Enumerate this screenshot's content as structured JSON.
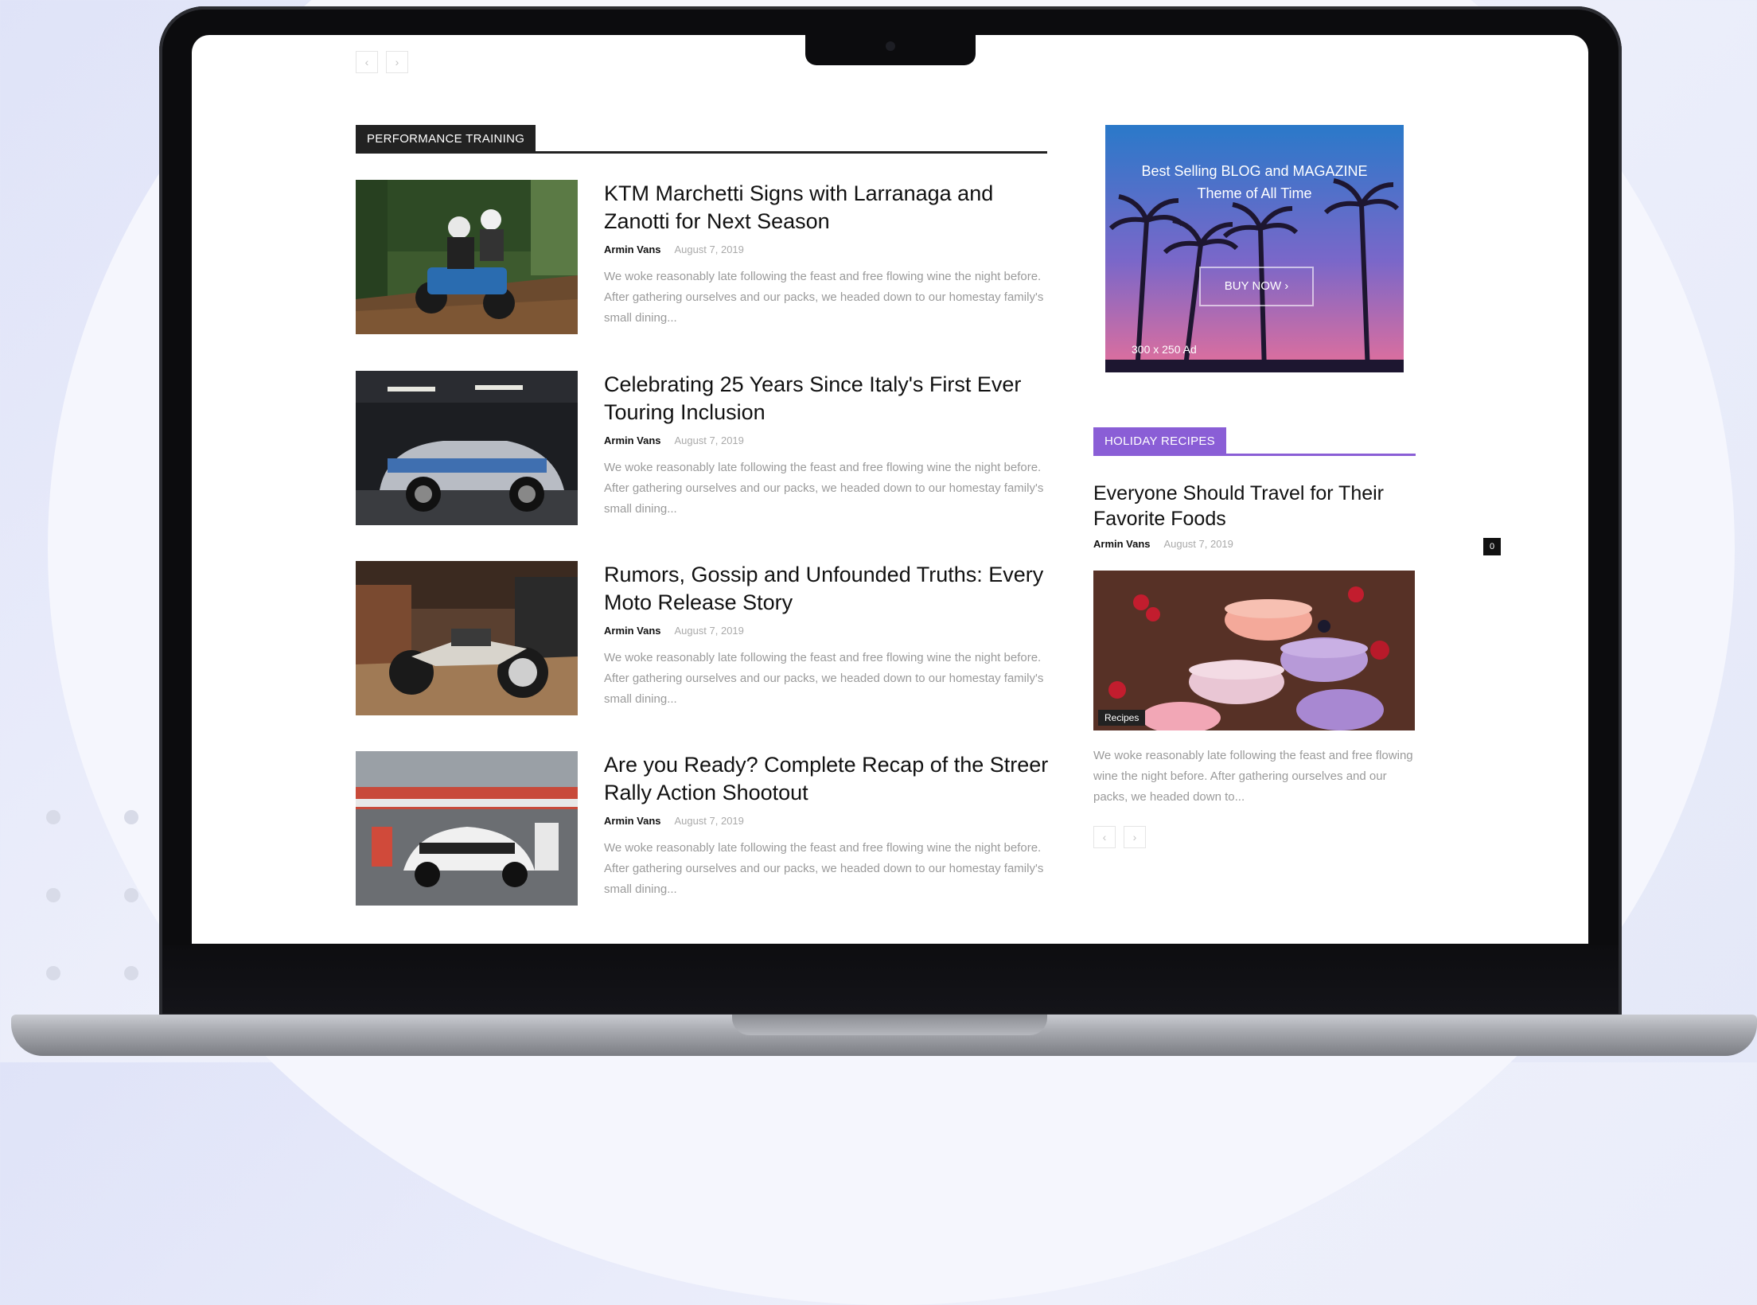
{
  "top_pager": {
    "prev": "‹",
    "next": "›"
  },
  "main": {
    "section_label": "PERFORMANCE TRAINING",
    "articles": [
      {
        "title": "KTM Marchetti Signs with Larranaga and Zanotti for Next Season",
        "author": "Armin Vans",
        "date": "August 7, 2019",
        "excerpt": "We woke reasonably late following the feast and free flowing wine the night before. After gathering ourselves and our packs, we headed down to our homestay family's small dining..."
      },
      {
        "title": "Celebrating 25 Years Since Italy's First Ever Touring Inclusion",
        "author": "Armin Vans",
        "date": "August 7, 2019",
        "excerpt": "We woke reasonably late following the feast and free flowing wine the night before. After gathering ourselves and our packs, we headed down to our homestay family's small dining..."
      },
      {
        "title": "Rumors, Gossip and Unfounded Truths: Every Moto Release Story",
        "author": "Armin Vans",
        "date": "August 7, 2019",
        "excerpt": "We woke reasonably late following the feast and free flowing wine the night before. After gathering ourselves and our packs, we headed down to our homestay family's small dining..."
      },
      {
        "title": "Are you Ready? Complete Recap of the Streer Rally Action Shootout",
        "author": "Armin Vans",
        "date": "August 7, 2019",
        "excerpt": "We woke reasonably late following the feast and free flowing wine the night before. After gathering ourselves and our packs, we headed down to our homestay family's small dining..."
      }
    ]
  },
  "sidebar": {
    "ad": {
      "headline_line1": "Best Selling BLOG and MAGAZINE",
      "headline_line2": "Theme of All Time",
      "button": "BUY NOW ›",
      "size_label": "300 x 250 Ad"
    },
    "section_label": "HOLIDAY RECIPES",
    "featured": {
      "title": "Everyone Should Travel for Their Favorite Foods",
      "author": "Armin Vans",
      "date": "August 7, 2019",
      "comments": "0",
      "category": "Recipes",
      "excerpt": "We woke reasonably late following the feast and free flowing wine the night before. After gathering ourselves and our packs, we headed down to..."
    },
    "pager": {
      "prev": "‹",
      "next": "›"
    }
  },
  "colors": {
    "accent_purple": "#8a5ed6",
    "section_dark": "#222222",
    "meta_gray": "#aaaaaa"
  }
}
